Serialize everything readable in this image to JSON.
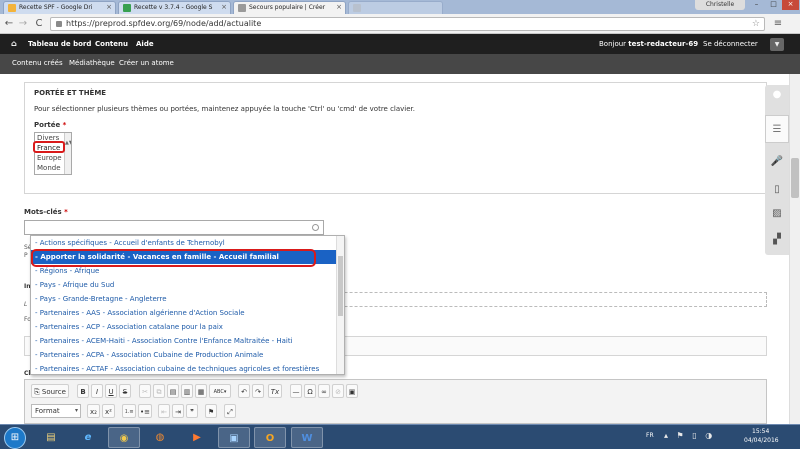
{
  "browser": {
    "tabs": [
      {
        "title": "Recette SPF - Google Dri",
        "fav_color": "#f3b33b"
      },
      {
        "title": "Recette v 3.7.4 - Google S",
        "fav_color": "#37a050"
      },
      {
        "title": "Secours populaire | Créer",
        "fav_color": "#9a9a9a"
      },
      {
        "title": "",
        "fav_color": "#c9c9c9"
      }
    ],
    "close_glyph": "×",
    "user_name": "Christelle",
    "win_min": "–",
    "win_max": "□",
    "win_close": "×",
    "back": "←",
    "forward": "→",
    "reload": "C",
    "url": "https://preprod.spfdev.org/69/node/add/actualite",
    "star": "☆",
    "menu": "≡"
  },
  "admin_bar": {
    "home": "⌂",
    "dashboard": "Tableau de bord",
    "content": "Contenu",
    "help": "Aide",
    "greeting_prefix": "Bonjour ",
    "user": "test-redacteur-69",
    "logout": "Se déconnecter",
    "toggle": "▼"
  },
  "shortcut_bar": {
    "items": [
      "Contenu créés",
      "Médiathèque",
      "Créer un atome"
    ]
  },
  "form": {
    "portee_section": {
      "legend": "PORTÉE ET THÈME",
      "help": "Pour sélectionner plusieurs thèmes ou portées, maintenez appuyée la touche 'Ctrl' ou 'cmd' de votre clavier.",
      "label": "Portée",
      "required_mark": "*",
      "options": [
        "Divers",
        "France",
        "Europe",
        "Monde"
      ],
      "scroll_arrows": "▲▼"
    },
    "mots_cles": {
      "label": "Mots-clés",
      "required_mark": "*",
      "value": ""
    },
    "stray_fragments": [
      "Sé",
      "P",
      "In",
      "L",
      "Fo",
      "M",
      "Cl"
    ]
  },
  "autocomplete": {
    "items": [
      "- Actions spécifiques - Accueil d'enfants de Tchernobyl",
      "- Apporter la solidarité - Vacances en famille - Accueil familial",
      "- Régions - Afrique",
      "- Pays - Afrique du Sud",
      "- Pays - Grande-Bretagne - Angleterre",
      "- Partenaires - AAS - Association algérienne d'Action Sociale",
      "- Partenaires - ACP - Association catalane pour la paix",
      "- Partenaires - ACEM-Haiti - Association Contre l'Enfance Maltraitée - Haiti",
      "- Partenaires - ACPA - Association Cubaine de Production Animale",
      "- Partenaires - ACTAF - Association cubaine de techniques agricoles et forestières"
    ],
    "selected_index": 1
  },
  "editor": {
    "row1": {
      "source": "⎘ Source",
      "bold": "B",
      "italic": "I",
      "underline": "U",
      "strike": "S",
      "cut": "✂",
      "copy": "⧉",
      "paste": "▤",
      "paste_text": "▥",
      "paste_word": "▦",
      "spell": "ABC▾",
      "undo": "↶",
      "redo": "↷",
      "remove_format": "Tx",
      "hr": "—",
      "omega": "Ω",
      "link": "∞",
      "unlink": "⊘",
      "image": "▣"
    },
    "row2": {
      "format": "Format",
      "format_arrow": "▾",
      "subscript": "x₂",
      "superscript": "x²",
      "numbered_list": "⒈≡",
      "bulleted_list": "•≡",
      "outdent": "⇤",
      "indent": "⇥",
      "blockquote": "❞",
      "flag": "⚑",
      "maximize": "⤢"
    }
  },
  "side_tray": {
    "icons": [
      "●",
      "☰",
      "🎤",
      "▯",
      "▨",
      "▞"
    ]
  },
  "taskbar": {
    "start": "⊞",
    "apps": [
      "▤",
      "e",
      "◉",
      "◍",
      "▶",
      "▣",
      "O",
      "W"
    ],
    "lang": "FR",
    "tray": "▴ ⚑ ▯ ◑",
    "time": "15:54",
    "date": "04/04/2016"
  }
}
